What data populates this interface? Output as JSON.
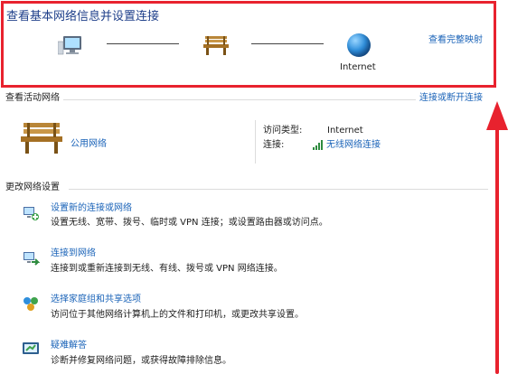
{
  "header": {
    "title": "查看基本网络信息并设置连接",
    "full_map_link": "查看完整映射"
  },
  "network_map": {
    "internet_label": "Internet"
  },
  "active_networks": {
    "heading": "查看活动网络",
    "connect_disconnect_link": "连接或断开连接",
    "network_name": "公用网络",
    "access_type_label": "访问类型:",
    "access_type_value": "Internet",
    "connection_label": "连接:",
    "connection_value": "无线网络连接"
  },
  "change_settings": {
    "heading": "更改网络设置",
    "tasks": [
      {
        "title": "设置新的连接或网络",
        "desc": "设置无线、宽带、拨号、临时或 VPN 连接；或设置路由器或访问点。",
        "icon": "network-setup-icon"
      },
      {
        "title": "连接到网络",
        "desc": "连接到或重新连接到无线、有线、拨号或 VPN 网络连接。",
        "icon": "connect-network-icon"
      },
      {
        "title": "选择家庭组和共享选项",
        "desc": "访问位于其他网络计算机上的文件和打印机，或更改共享设置。",
        "icon": "homegroup-icon"
      },
      {
        "title": "疑难解答",
        "desc": "诊断并修复网络问题，或获得故障排除信息。",
        "icon": "troubleshoot-icon"
      }
    ]
  },
  "colors": {
    "link": "#1a63b8",
    "highlight": "#e8222e",
    "network_link": "#2e8b3f"
  }
}
